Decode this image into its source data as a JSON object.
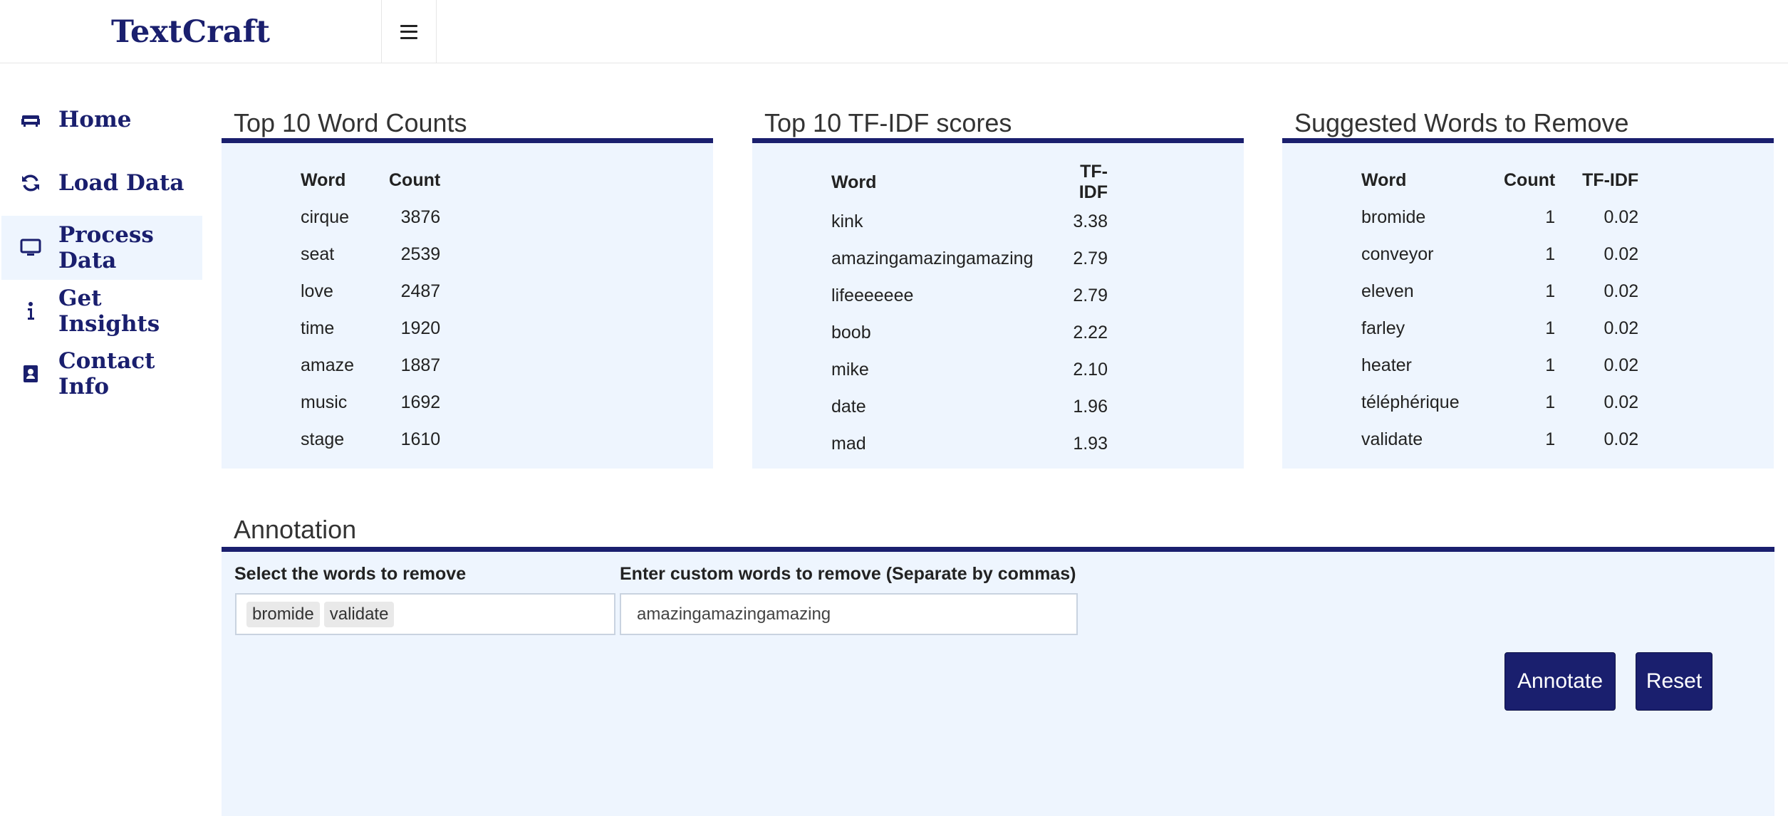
{
  "app": {
    "brand": "TextCraft"
  },
  "sidebar": {
    "items": [
      {
        "label": "Home",
        "icon": "couch-icon"
      },
      {
        "label": "Load Data",
        "icon": "refresh-icon"
      },
      {
        "label": "Process Data",
        "icon": "monitor-icon",
        "active": true
      },
      {
        "label": "Get Insights",
        "icon": "info-icon"
      },
      {
        "label": "Contact Info",
        "icon": "address-book-icon"
      }
    ]
  },
  "word_counts": {
    "title": "Top 10 Word Counts",
    "headers": [
      "Word",
      "Count"
    ],
    "rows": [
      [
        "cirque",
        "3876"
      ],
      [
        "seat",
        "2539"
      ],
      [
        "love",
        "2487"
      ],
      [
        "time",
        "1920"
      ],
      [
        "amaze",
        "1887"
      ],
      [
        "music",
        "1692"
      ],
      [
        "stage",
        "1610"
      ]
    ]
  },
  "tfidf": {
    "title": "Top 10 TF-IDF scores",
    "headers": [
      "Word",
      "TF-IDF"
    ],
    "rows": [
      [
        "kink",
        "3.38"
      ],
      [
        "amazingamazingamazing",
        "2.79"
      ],
      [
        "lifeeeeeee",
        "2.79"
      ],
      [
        "boob",
        "2.22"
      ],
      [
        "mike",
        "2.10"
      ],
      [
        "date",
        "1.96"
      ],
      [
        "mad",
        "1.93"
      ]
    ]
  },
  "suggested": {
    "title": "Suggested Words to Remove",
    "headers": [
      "Word",
      "Count",
      "TF-IDF"
    ],
    "rows": [
      [
        "bromide",
        "1",
        "0.02"
      ],
      [
        "conveyor",
        "1",
        "0.02"
      ],
      [
        "eleven",
        "1",
        "0.02"
      ],
      [
        "farley",
        "1",
        "0.02"
      ],
      [
        "heater",
        "1",
        "0.02"
      ],
      [
        "téléphérique",
        "1",
        "0.02"
      ],
      [
        "validate",
        "1",
        "0.02"
      ]
    ]
  },
  "annotation": {
    "title": "Annotation",
    "select_label": "Select the words to remove",
    "selected": [
      "bromide",
      "validate"
    ],
    "custom_label": "Enter custom words to remove (Separate by commas)",
    "custom_value": "amazingamazingamazing",
    "annotate_label": "Annotate",
    "reset_label": "Reset"
  },
  "colors": {
    "primary": "#1a1f6e",
    "panel": "#eef5fe"
  }
}
